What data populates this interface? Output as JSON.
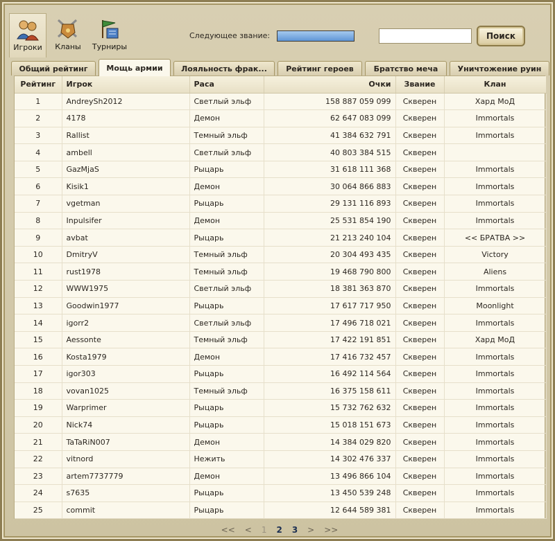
{
  "nav": {
    "players": "Игроки",
    "clans": "Кланы",
    "tournaments": "Турниры"
  },
  "top": {
    "next_rank_label": "Следующее звание:",
    "search_value": "",
    "search_button": "Поиск"
  },
  "progress": {
    "next_rank_fraction": 1.0
  },
  "tabs": [
    {
      "label": "Общий рейтинг",
      "active": false
    },
    {
      "label": "Мощь армии",
      "active": true
    },
    {
      "label": "Лояльность фрак...",
      "active": false
    },
    {
      "label": "Рейтинг героев",
      "active": false
    },
    {
      "label": "Братство меча",
      "active": false
    },
    {
      "label": "Уничтожение руин",
      "active": false
    }
  ],
  "table": {
    "headers": {
      "rank": "Рейтинг",
      "player": "Игрок",
      "race": "Раса",
      "score": "Очки",
      "title": "Звание",
      "clan": "Клан"
    },
    "rows": [
      {
        "rank": "1",
        "player": "AndreySh2012",
        "race": "Светлый эльф",
        "score": "158 887 059 099",
        "title": "Скверен",
        "clan": "Хард МоД"
      },
      {
        "rank": "2",
        "player": "4178",
        "race": "Демон",
        "score": "62 647 083 099",
        "title": "Скверен",
        "clan": "Immortals"
      },
      {
        "rank": "3",
        "player": "Rallist",
        "race": "Темный эльф",
        "score": "41 384 632 791",
        "title": "Скверен",
        "clan": "Immortals"
      },
      {
        "rank": "4",
        "player": "ambell",
        "race": "Светлый эльф",
        "score": "40 803 384 515",
        "title": "Скверен",
        "clan": ""
      },
      {
        "rank": "5",
        "player": "GazMjaS",
        "race": "Рыцарь",
        "score": "31 618 111 368",
        "title": "Скверен",
        "clan": "Immortals"
      },
      {
        "rank": "6",
        "player": "Kisik1",
        "race": "Демон",
        "score": "30 064 866 883",
        "title": "Скверен",
        "clan": "Immortals"
      },
      {
        "rank": "7",
        "player": "vgetman",
        "race": "Рыцарь",
        "score": "29 131 116 893",
        "title": "Скверен",
        "clan": "Immortals"
      },
      {
        "rank": "8",
        "player": "Inpulsifer",
        "race": "Демон",
        "score": "25 531 854 190",
        "title": "Скверен",
        "clan": "Immortals"
      },
      {
        "rank": "9",
        "player": "avbat",
        "race": "Рыцарь",
        "score": "21 213 240 104",
        "title": "Скверен",
        "clan": "<< БРАТВА >>"
      },
      {
        "rank": "10",
        "player": "DmitryV",
        "race": "Темный эльф",
        "score": "20 304 493 435",
        "title": "Скверен",
        "clan": "Victory"
      },
      {
        "rank": "11",
        "player": "rust1978",
        "race": "Темный эльф",
        "score": "19 468 790 800",
        "title": "Скверен",
        "clan": "Aliens"
      },
      {
        "rank": "12",
        "player": "WWW1975",
        "race": "Светлый эльф",
        "score": "18 381 363 870",
        "title": "Скверен",
        "clan": "Immortals"
      },
      {
        "rank": "13",
        "player": "Goodwin1977",
        "race": "Рыцарь",
        "score": "17 617 717 950",
        "title": "Скверен",
        "clan": "Moonlight"
      },
      {
        "rank": "14",
        "player": "igorr2",
        "race": "Светлый эльф",
        "score": "17 496 718 021",
        "title": "Скверен",
        "clan": "Immortals"
      },
      {
        "rank": "15",
        "player": "Aessonte",
        "race": "Темный эльф",
        "score": "17 422 191 851",
        "title": "Скверен",
        "clan": "Хард МоД"
      },
      {
        "rank": "16",
        "player": "Kosta1979",
        "race": "Демон",
        "score": "17 416 732 457",
        "title": "Скверен",
        "clan": "Immortals"
      },
      {
        "rank": "17",
        "player": "igor303",
        "race": "Рыцарь",
        "score": "16 492 114 564",
        "title": "Скверен",
        "clan": "Immortals"
      },
      {
        "rank": "18",
        "player": "vovan1025",
        "race": "Темный эльф",
        "score": "16 375 158 611",
        "title": "Скверен",
        "clan": "Immortals"
      },
      {
        "rank": "19",
        "player": "Warprimer",
        "race": "Рыцарь",
        "score": "15 732 762 632",
        "title": "Скверен",
        "clan": "Immortals"
      },
      {
        "rank": "20",
        "player": "Nick74",
        "race": "Рыцарь",
        "score": "15 018 151 673",
        "title": "Скверен",
        "clan": "Immortals"
      },
      {
        "rank": "21",
        "player": "TaTaRiN007",
        "race": "Демон",
        "score": "14 384 029 820",
        "title": "Скверен",
        "clan": "Immortals"
      },
      {
        "rank": "22",
        "player": "vitnord",
        "race": "Нежить",
        "score": "14 302 476 337",
        "title": "Скверен",
        "clan": "Immortals"
      },
      {
        "rank": "23",
        "player": "artem7737779",
        "race": "Демон",
        "score": "13 496 866 104",
        "title": "Скверен",
        "clan": "Immortals"
      },
      {
        "rank": "24",
        "player": "s7635",
        "race": "Рыцарь",
        "score": "13 450 539 248",
        "title": "Скверен",
        "clan": "Immortals"
      },
      {
        "rank": "25",
        "player": "commit",
        "race": "Рыцарь",
        "score": "12 644 589 381",
        "title": "Скверен",
        "clan": "Immortals"
      }
    ]
  },
  "pager": {
    "first": "<<",
    "prev": "<",
    "pages": [
      {
        "label": "1",
        "current": true
      },
      {
        "label": "2",
        "current": false
      },
      {
        "label": "3",
        "current": false
      }
    ],
    "next": ">",
    "last": ">>"
  }
}
